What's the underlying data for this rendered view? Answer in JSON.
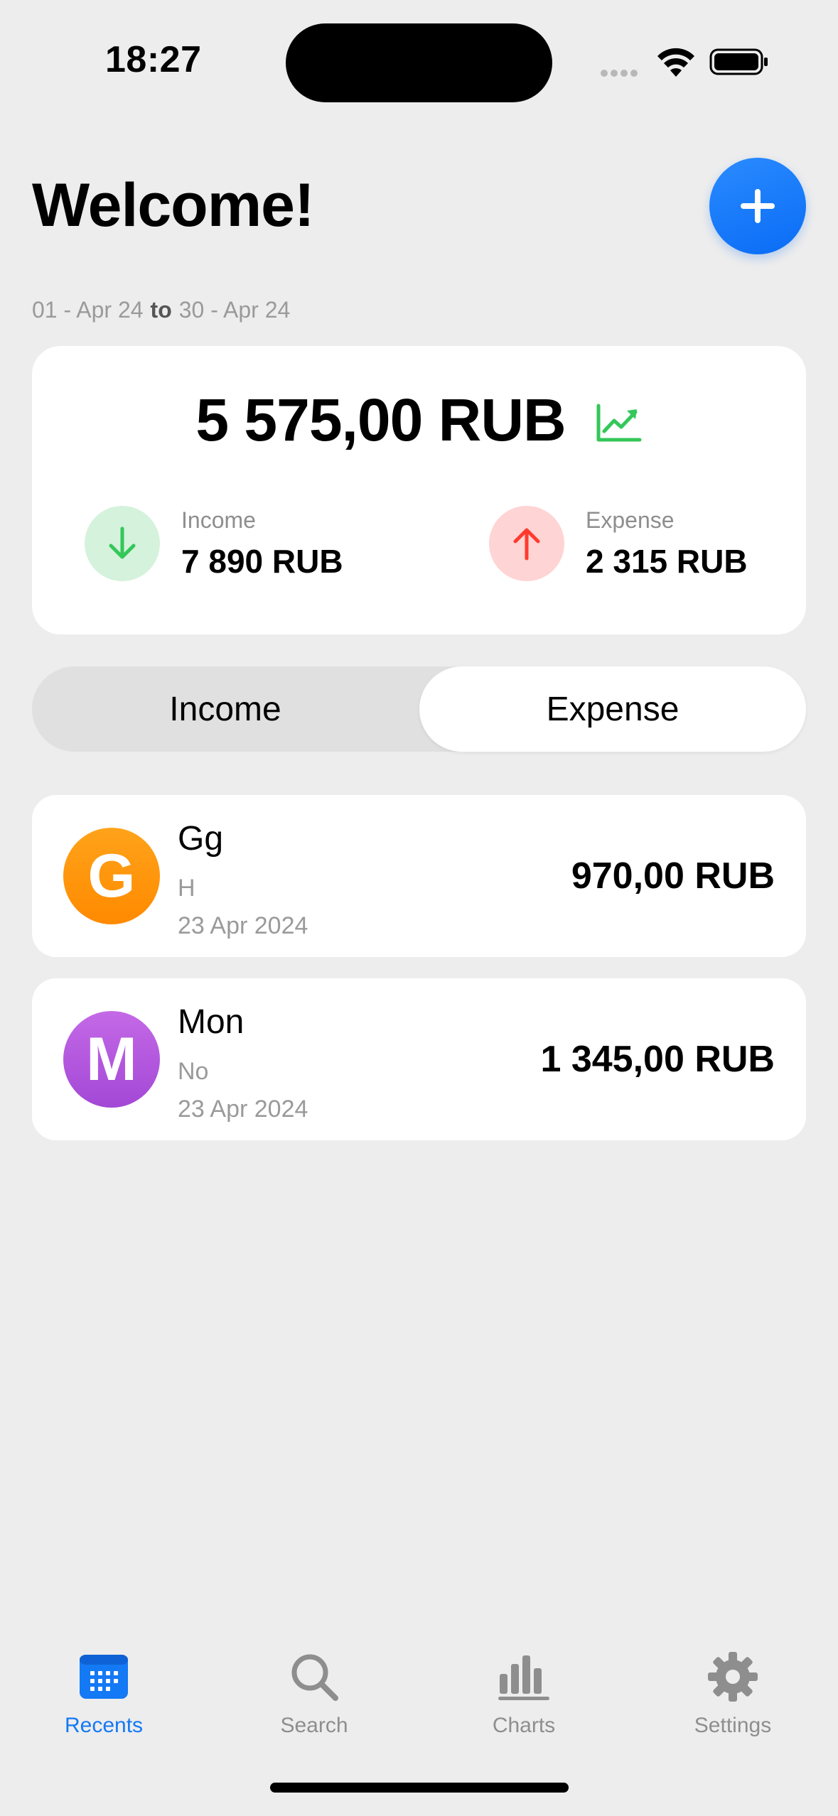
{
  "status_bar": {
    "time": "18:27"
  },
  "header": {
    "title": "Welcome!",
    "add_icon": "plus-icon"
  },
  "date_range": {
    "start": "01 - Apr 24",
    "separator": "to",
    "end": "30 - Apr 24"
  },
  "summary": {
    "balance": "5 575,00 RUB",
    "trend_icon": "chart-line-uptrend-icon",
    "income": {
      "label": "Income",
      "value": "7 890 RUB",
      "color": "#34C759"
    },
    "expense": {
      "label": "Expense",
      "value": "2 315 RUB",
      "color": "#FF3B30"
    }
  },
  "segmented": {
    "income_label": "Income",
    "expense_label": "Expense",
    "selected": "Expense"
  },
  "transactions": [
    {
      "initial": "G",
      "name": "Gg",
      "note": "H",
      "date": "23 Apr 2024",
      "amount": "970,00 RUB",
      "color": "#FF9500"
    },
    {
      "initial": "M",
      "name": "Mon",
      "note": "No",
      "date": "23 Apr 2024",
      "amount": "1 345,00 RUB",
      "color": "#AF52DE"
    }
  ],
  "tabs": [
    {
      "label": "Recents",
      "icon": "calendar-icon",
      "active": true
    },
    {
      "label": "Search",
      "icon": "magnifier-icon",
      "active": false
    },
    {
      "label": "Charts",
      "icon": "bar-chart-icon",
      "active": false
    },
    {
      "label": "Settings",
      "icon": "gear-icon",
      "active": false
    }
  ],
  "colors": {
    "accent": "#1479F5",
    "background": "#EDEDED",
    "inactive": "#8E8E8E"
  }
}
